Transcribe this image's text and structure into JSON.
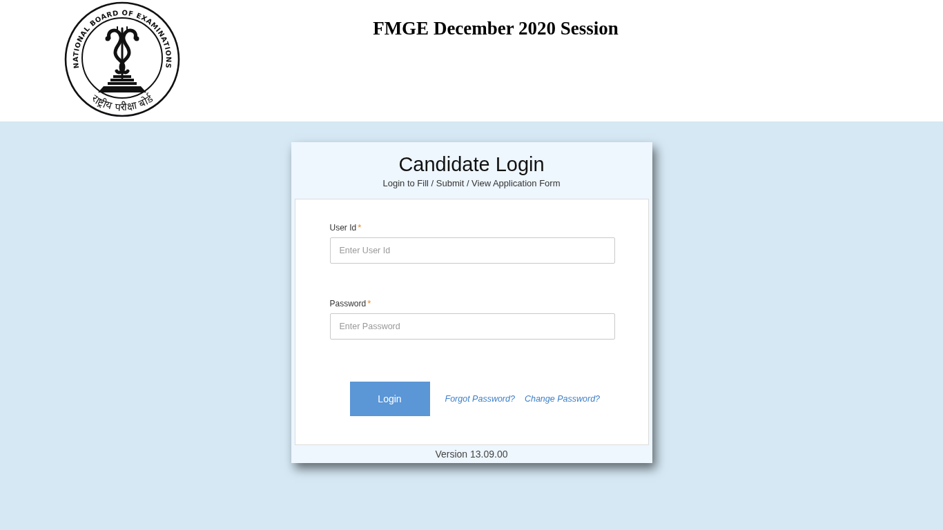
{
  "header": {
    "logo": {
      "ring_text": "NATIONAL BOARD OF EXAMINATIONS",
      "bottom_text": "राष्ट्रीय परीक्षा बोर्ड"
    },
    "title": "FMGE December 2020 Session"
  },
  "login_card": {
    "title": "Candidate Login",
    "subtitle": "Login to Fill / Submit / View Application Form",
    "fields": [
      {
        "label": "User Id",
        "required_mark": "*",
        "placeholder": "Enter User Id"
      },
      {
        "label": "Password",
        "required_mark": "*",
        "placeholder": "Enter Password"
      }
    ],
    "submit_button": "Login",
    "links": [
      "Forgot Password?",
      "Change Password?"
    ],
    "version": "Version 13.09.00"
  }
}
